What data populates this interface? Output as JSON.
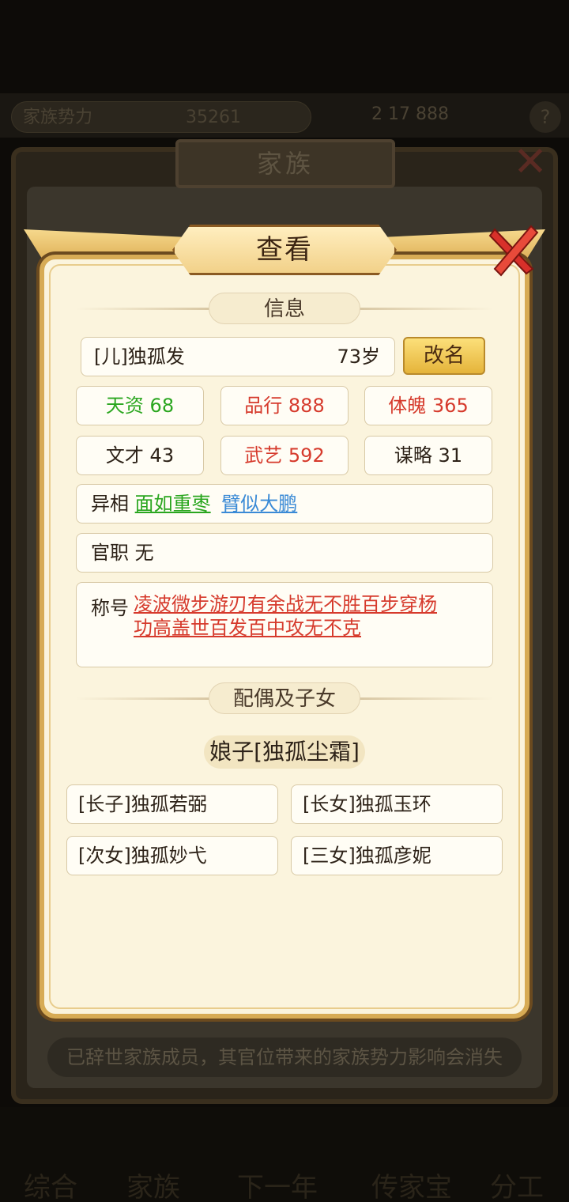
{
  "background": {
    "power_label": "家族势力",
    "power_value": "35261",
    "resources": "2 17 888",
    "help_icon": "question-icon",
    "window_title": "家族",
    "notice": "已辞世家族成员，其官位带来的家族势力影响会消失",
    "nav": [
      "综合",
      "家族",
      "下一年",
      "传家宝",
      "分工"
    ]
  },
  "dialog": {
    "title": "查看",
    "info_section": "信息",
    "name": "[儿]独孤发",
    "age": "73岁",
    "rename_label": "改名",
    "stats": [
      {
        "label": "天资",
        "value": "68",
        "color": "#2aa61f"
      },
      {
        "label": "品行",
        "value": "888",
        "color": "#d63a2c"
      },
      {
        "label": "体魄",
        "value": "365",
        "color": "#d63a2c"
      },
      {
        "label": "文才",
        "value": "43",
        "color": "#2d2218"
      },
      {
        "label": "武艺",
        "value": "592",
        "color": "#d63a2c"
      },
      {
        "label": "谋略",
        "value": "31",
        "color": "#2d2218"
      }
    ],
    "features_label": "异相",
    "features": [
      "面如重枣",
      "臂似大鹏"
    ],
    "position_label": "官职",
    "position_value": "无",
    "titles_label": "称号",
    "titles_line1": "凌波微步游刃有余战无不胜百步穿杨",
    "titles_line2": "功高盖世百发百中攻无不克",
    "family_section": "配偶及子女",
    "spouse": "娘子[独孤尘霜]",
    "children": [
      "[长子]独孤若弼",
      "[长女]独孤玉环",
      "[次女]独孤妙弋",
      "[三女]独孤彦妮"
    ]
  }
}
